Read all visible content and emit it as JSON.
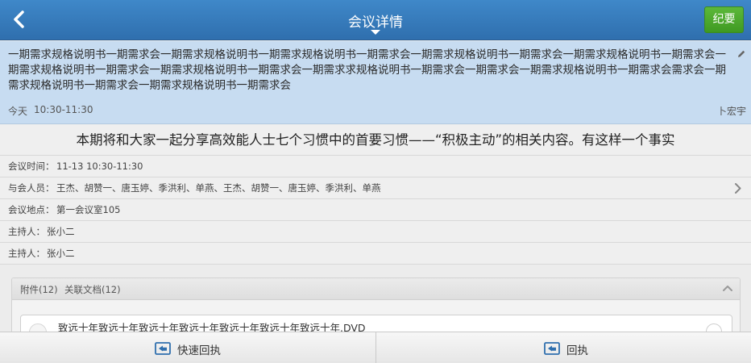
{
  "header": {
    "title": "会议详情",
    "minutes_button": "纪要"
  },
  "info": {
    "long_title": "一期需求规格说明书一期需求会一期需求规格说明书一期需求规格说明书一期需求会一期需求规格说明书一期需求会一期需求规格说明书一期需求会一期需求规格说明书一期需求会一期需求规格说明书一期需求会一期需求求规格说明书一期需求会一期需求会一期需求规格说明书一期需求会需求会一期需求规格说明书一期需求会一期需求规格说明书一期需求会",
    "day": "今天",
    "time": "10:30-11:30",
    "author": "卜宏宇"
  },
  "summary": "本期将和大家一起分享高效能人士七个习惯中的首要习惯——“积极主动”的相关内容。有这样一个事实",
  "details": {
    "time_label": "会议时间：",
    "time_value": "11-13 10:30-11:30",
    "attendees_label": "与会人员：",
    "attendees_value": "王杰、胡赞一、唐玉婷、季洪利、单燕、王杰、胡赞一、唐玉婷、季洪利、单燕",
    "location_label": "会议地点：",
    "location_value": "第一会议室105",
    "host1_label": "主持人：",
    "host1_value": "张小二",
    "host2_label": "主持人：",
    "host2_value": "张小二"
  },
  "attachments": {
    "tab_files": "附件(12)",
    "tab_docs": "关联文档(12)",
    "items": [
      {
        "name": "致远十年致远十年致远十年致远十年致远十年致远十年致远十年.DVD"
      }
    ]
  },
  "bottom": {
    "quick_reply": "快速回执",
    "reply": "回执"
  },
  "colors": {
    "header_blue": "#3479bb",
    "info_bg": "#c7dcf1",
    "minutes_green": "#4caa2c"
  }
}
